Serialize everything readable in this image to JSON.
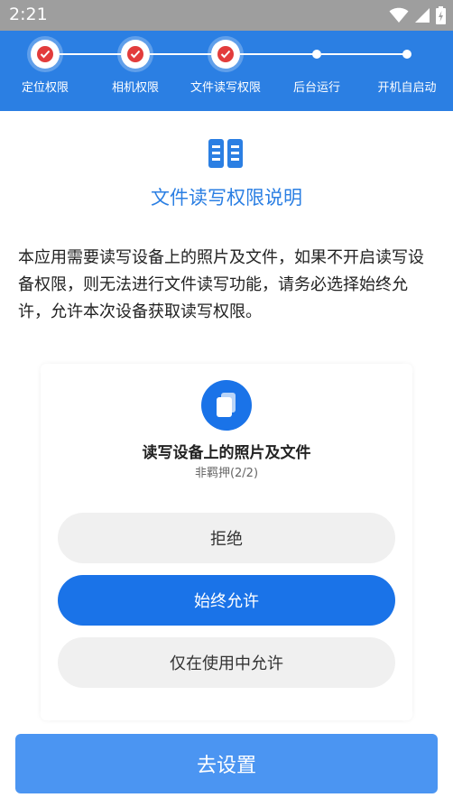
{
  "status_bar": {
    "time": "2:21",
    "icons": [
      "wifi-icon",
      "signal-icon",
      "battery-charging-icon"
    ]
  },
  "stepper": {
    "steps": [
      {
        "label": "定位权限",
        "state": "done"
      },
      {
        "label": "相机权限",
        "state": "done"
      },
      {
        "label": "文件读写权限",
        "state": "current"
      },
      {
        "label": "后台运行",
        "state": "pending"
      },
      {
        "label": "开机自启动",
        "state": "pending"
      }
    ],
    "colors": {
      "background": "#2b7fe3",
      "check": "#e23c3c"
    }
  },
  "content": {
    "icon": "document-book-icon",
    "title": "文件读写权限说明",
    "description": "本应用需要读写设备上的照片及文件，如果不开启读写设备权限，则无法进行文件读写功能，请务必选择始终允许，允许本次设备获取读写权限。"
  },
  "dialog": {
    "icon": "files-icon",
    "title": "读写设备上的照片及文件",
    "subtitle": "非羁押(2/2)",
    "options": {
      "deny": "拒绝",
      "always_allow": "始终允许",
      "allow_while_using": "仅在使用中允许"
    }
  },
  "footer": {
    "button_label": "去设置",
    "button_color": "#4b95f2"
  }
}
